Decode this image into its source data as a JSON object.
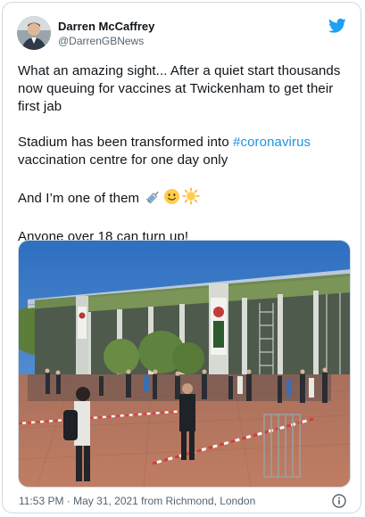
{
  "author": {
    "display_name": "Darren McCaffrey",
    "handle": "@DarrenGBNews",
    "avatar_icon": "person-avatar-icon"
  },
  "brand": {
    "icon": "twitter-bird-icon",
    "color": "#1da1f2"
  },
  "tweet": {
    "line1": "What an amazing sight... After a quiet start thousands now queuing for vaccines at Twickenham to get their first jab",
    "line2_before": "Stadium has been transformed into ",
    "hashtag": "#coronavirus",
    "line2_after": " vaccination centre for one day only",
    "line3": "And I’m one of them",
    "line3_emojis": [
      "syringe-icon",
      "smiling-face-icon",
      "sun-icon"
    ],
    "line4": "Anyone over 18 can turn up!"
  },
  "photo": {
    "icon": "stadium-queue-photo",
    "colors": {
      "sky": "#3a78c4",
      "pavement": "#b5735d"
    }
  },
  "footer": {
    "timestamp": "11:53 PM · May 31, 2021 from Richmond, London",
    "info_icon": "info-icon"
  }
}
